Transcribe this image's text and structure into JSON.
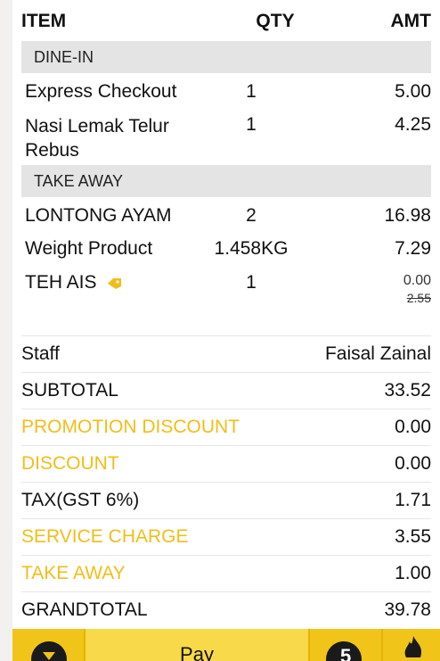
{
  "headers": {
    "item": "ITEM",
    "qty": "QTY",
    "amt": "AMT"
  },
  "sections": [
    {
      "title": "DINE-IN",
      "items": [
        {
          "name": "Express Checkout",
          "qty": "1",
          "amt": "5.00"
        },
        {
          "name": "Nasi Lemak Telur Rebus",
          "qty": "1",
          "amt": "4.25"
        }
      ]
    },
    {
      "title": "TAKE AWAY",
      "items": [
        {
          "name": "LONTONG AYAM",
          "qty": "2",
          "amt": "16.98"
        },
        {
          "name": "Weight Product",
          "qty": "1.458KG",
          "amt": "7.29"
        },
        {
          "name": "TEH AIS",
          "qty": "1",
          "amt": "0.00",
          "original_amt": "2.55",
          "tag_icon": "price-tag-icon"
        }
      ]
    }
  ],
  "summary": {
    "staff": {
      "label": "Staff",
      "value": "Faisal Zainal"
    },
    "subtotal": {
      "label": "SUBTOTAL",
      "value": "33.52"
    },
    "promotion_discount": {
      "label": "PROMOTION DISCOUNT",
      "value": "0.00"
    },
    "discount": {
      "label": "DISCOUNT",
      "value": "0.00"
    },
    "tax": {
      "label": "TAX(GST 6%)",
      "value": "1.71"
    },
    "service_charge": {
      "label": "SERVICE CHARGE",
      "value": "3.55"
    },
    "take_away": {
      "label": "TAKE AWAY",
      "value": "1.00"
    },
    "grandtotal": {
      "label": "GRANDTOTAL",
      "value": "39.78"
    }
  },
  "bottom_bar": {
    "pay_label": "Pay",
    "count": "5",
    "left_icon": "chevron-down-circle-icon",
    "right_icon": "flame-icon"
  },
  "colors": {
    "accent": "#f2bd1a",
    "bar": "#f4d23a",
    "section_bg": "#e4e4e4"
  }
}
